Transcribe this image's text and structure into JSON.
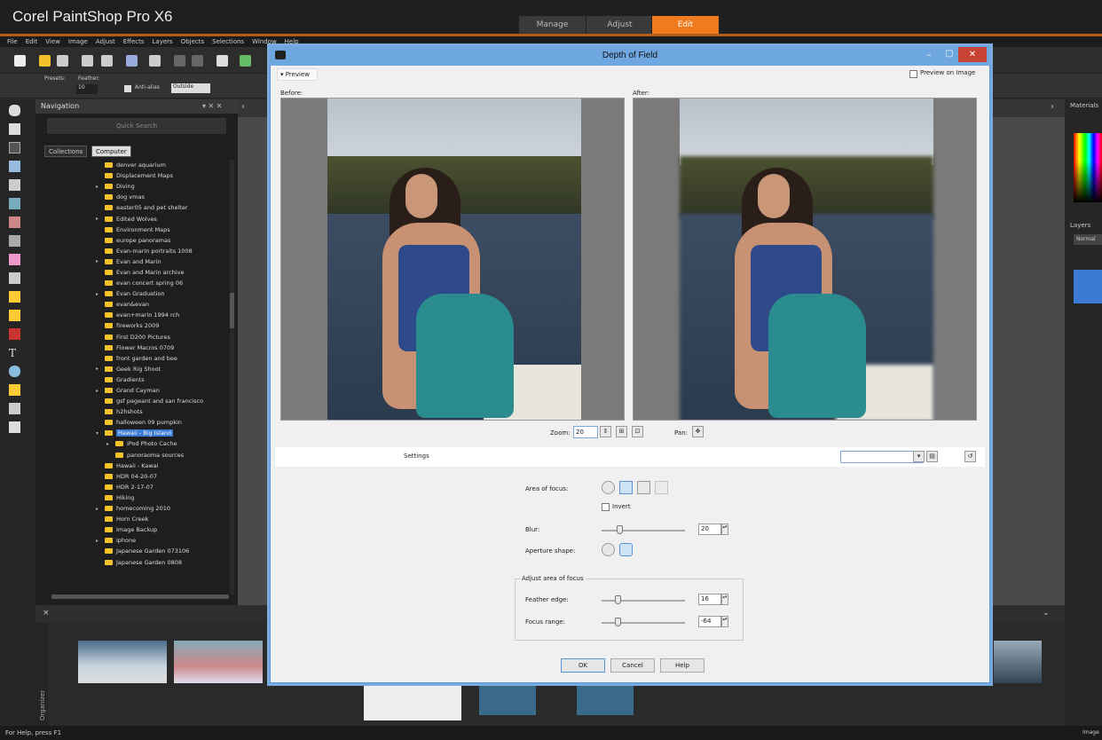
{
  "app": {
    "title": "Corel PaintShop Pro X6"
  },
  "workspace_tabs": [
    {
      "label": "Manage"
    },
    {
      "label": "Adjust"
    },
    {
      "label": "Edit",
      "active": true
    }
  ],
  "menu": [
    "File",
    "Edit",
    "View",
    "Image",
    "Adjust",
    "Effects",
    "Layers",
    "Objects",
    "Selections",
    "Window",
    "Help"
  ],
  "options_bar": {
    "presets_label": "Presets:",
    "feather_label": "Feather:",
    "feather_value": "10",
    "antialias_label": "Anti-alias",
    "mode_value": "Outside"
  },
  "navigation": {
    "title": "Navigation",
    "search_placeholder": "Quick Search",
    "tabs": [
      "Collections",
      "Computer"
    ],
    "selected_tab": "Computer",
    "folders": [
      {
        "label": "denver aquarium",
        "indent": 0
      },
      {
        "label": "Displacement Maps",
        "indent": 0
      },
      {
        "label": "Diving",
        "indent": 0,
        "expandable": true
      },
      {
        "label": "dog vmas",
        "indent": 0
      },
      {
        "label": "easter05 and pet shelter",
        "indent": 0
      },
      {
        "label": "Edited Wolves",
        "indent": 0,
        "expandable": true
      },
      {
        "label": "Environment Maps",
        "indent": 0
      },
      {
        "label": "europe panoramas",
        "indent": 0
      },
      {
        "label": "Evan-marin portraits 1008",
        "indent": 0
      },
      {
        "label": "Evan and Marin",
        "indent": 0,
        "expandable": true
      },
      {
        "label": "Evan and Marin archive",
        "indent": 0
      },
      {
        "label": "evan concert spring 06",
        "indent": 0
      },
      {
        "label": "Evan Graduation",
        "indent": 0,
        "expandable": true
      },
      {
        "label": "evan&evan",
        "indent": 0
      },
      {
        "label": "evan+marin 1994 rch",
        "indent": 0
      },
      {
        "label": "fireworks 2009",
        "indent": 0
      },
      {
        "label": "First D200 Pictures",
        "indent": 0
      },
      {
        "label": "Flower Macros 0709",
        "indent": 0
      },
      {
        "label": "front garden and bee",
        "indent": 0
      },
      {
        "label": "Geek Rig Shoot",
        "indent": 0,
        "expandable": true
      },
      {
        "label": "Gradients",
        "indent": 0
      },
      {
        "label": "Grand Cayman",
        "indent": 0,
        "expandable": true
      },
      {
        "label": "gsf pageant and san francisco",
        "indent": 0
      },
      {
        "label": "h2hshots",
        "indent": 0
      },
      {
        "label": "halloween 09 pumpkin",
        "indent": 0
      },
      {
        "label": "Hawaii - Big Island",
        "indent": 0,
        "expanded": true,
        "selected": true
      },
      {
        "label": "iPod Photo Cache",
        "indent": 1,
        "expandable": true
      },
      {
        "label": "panoraoma sources",
        "indent": 1
      },
      {
        "label": "Hawaii - Kawai",
        "indent": 0
      },
      {
        "label": "HDR 04-20-07",
        "indent": 0
      },
      {
        "label": "HDR 2-17-07",
        "indent": 0
      },
      {
        "label": "Hiking",
        "indent": 0
      },
      {
        "label": "homecoming 2010",
        "indent": 0,
        "expandable": true
      },
      {
        "label": "Horn Creek",
        "indent": 0
      },
      {
        "label": "Image Backup",
        "indent": 0
      },
      {
        "label": "iphone",
        "indent": 0,
        "expandable": true
      },
      {
        "label": "Japanese Garden 073106",
        "indent": 0
      },
      {
        "label": "Japanese Garden 0808",
        "indent": 0
      }
    ]
  },
  "right_panels": {
    "materials": "Materials",
    "layers": "Layers",
    "layer_mode": "Normal"
  },
  "organizer": {
    "label": "Organizer"
  },
  "status": {
    "text": "For Help, press F1",
    "right": "Image"
  },
  "dialog": {
    "title": "Depth of Field",
    "preview_toggle": "Preview",
    "preview_on_image": "Preview on Image",
    "before_label": "Before:",
    "after_label": "After:",
    "zoom_label": "Zoom:",
    "zoom_value": "20",
    "pan_label": "Pan:",
    "settings_label": "Settings",
    "area_of_focus_label": "Area of focus:",
    "invert_label": "Invert",
    "blur_label": "Blur:",
    "blur_value": "20",
    "aperture_label": "Aperture shape:",
    "adjust_group_label": "Adjust area of focus",
    "feather_label": "Feather edge:",
    "feather_value": "16",
    "focus_range_label": "Focus range:",
    "focus_range_value": "-64",
    "buttons": {
      "ok": "OK",
      "cancel": "Cancel",
      "help": "Help"
    }
  }
}
